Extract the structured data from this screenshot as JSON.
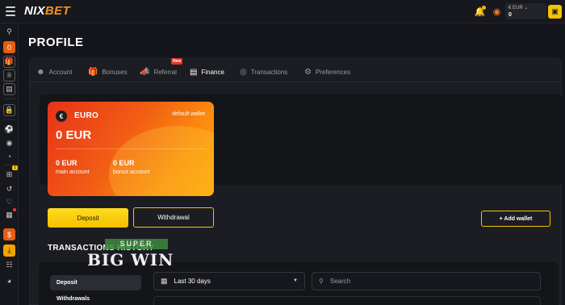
{
  "header": {
    "logo_main": "NIX",
    "logo_accent": "BET",
    "balance_currency": "EUR",
    "balance_amount": "0"
  },
  "page": {
    "title": "PROFILE"
  },
  "tabs": [
    {
      "label": "Account",
      "icon": "user-icon"
    },
    {
      "label": "Bonuses",
      "icon": "gift-icon"
    },
    {
      "label": "Referral",
      "icon": "megaphone-icon",
      "badge": "New"
    },
    {
      "label": "Finance",
      "icon": "wallet-icon",
      "active": true
    },
    {
      "label": "Transactions",
      "icon": "coins-icon"
    },
    {
      "label": "Preferences",
      "icon": "gear-icon"
    }
  ],
  "wallet_card": {
    "currency_symbol": "€",
    "currency_name": "EURO",
    "default_label": "default wallet",
    "amount": "0 EUR",
    "main_amount": "0 EUR",
    "main_label": "main account",
    "bonus_amount": "0 EUR",
    "bonus_label": "bonus account"
  },
  "actions": {
    "deposit": "Deposit",
    "withdrawal": "Withdrawal",
    "add_wallet": "+ Add wallet"
  },
  "transactions": {
    "title": "TRANSACTIONS HISTORY",
    "side_items": [
      "Deposit",
      "Withdrawals"
    ],
    "date_filter": "Last 30 days",
    "search_placeholder": "Search"
  },
  "watermark": {
    "top": "SUPER",
    "main": "BIG WIN"
  },
  "colors": {
    "accent": "#f5c400",
    "brand_orange": "#f7931e",
    "card_start": "#e8321a",
    "card_end": "#ffa707"
  }
}
